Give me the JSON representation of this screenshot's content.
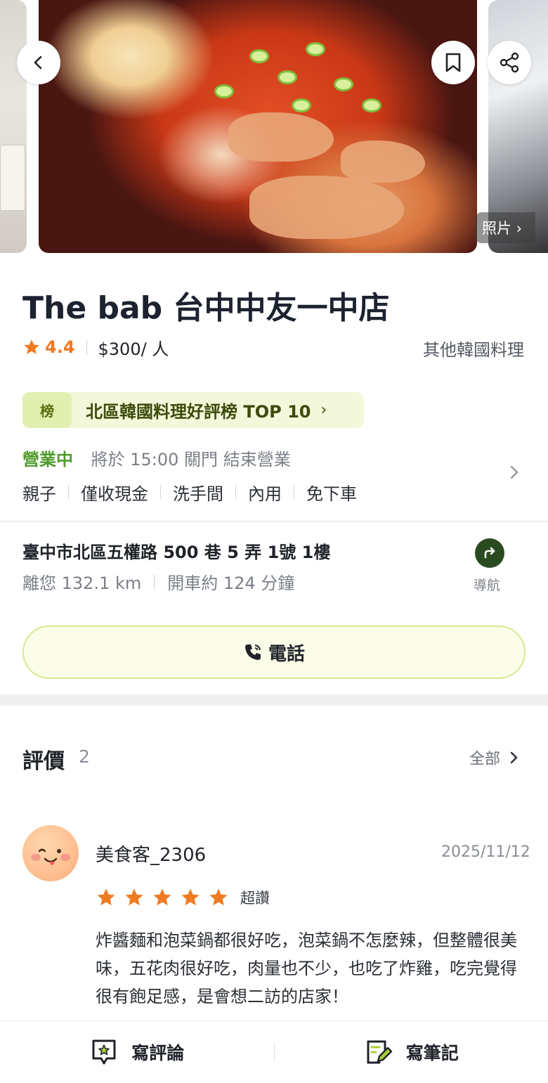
{
  "hero": {
    "photos_label": "照片 ›"
  },
  "restaurant": {
    "name": "The bab 台中中友一中店",
    "rating": "4.4",
    "price": "$300/ 人",
    "cuisine": "其他韓國料理"
  },
  "ranking": {
    "badge": "榜",
    "text": "北區韓國料理好評榜 TOP 10",
    "chevron": "›"
  },
  "hours": {
    "status": "營業中",
    "detail": "將於 15:00 關門 結束營業"
  },
  "amenities": [
    "親子",
    "僅收現金",
    "洗手間",
    "內用",
    "免下車"
  ],
  "address": {
    "line": "臺中市北區五權路 500 巷 5 弄 1號 1樓",
    "distance": "離您 132.1 km",
    "drive": "開車約 124 分鐘",
    "nav_label": "導航"
  },
  "call": {
    "label": "電話"
  },
  "reviews": {
    "heading": "評價",
    "count": "2",
    "all_label": "全部",
    "items": [
      {
        "user": "美食客_2306",
        "date": "2025/11/12",
        "stars": 5,
        "tag": "超讚",
        "text": "炸醬麵和泡菜鍋都很好吃，泡菜鍋不怎麼辣，但整體很美味，五花肉很好吃，肉量也不少，也吃了炸雞，吃完覺得很有飽足感，是會想二訪的店家！"
      }
    ]
  },
  "bottom_bar": {
    "write_review": "寫評論",
    "write_note": "寫筆記"
  },
  "colors": {
    "accent_green": "#4f9a2c",
    "star_orange": "#f07a22",
    "rank_bg": "#f2f8d9"
  }
}
